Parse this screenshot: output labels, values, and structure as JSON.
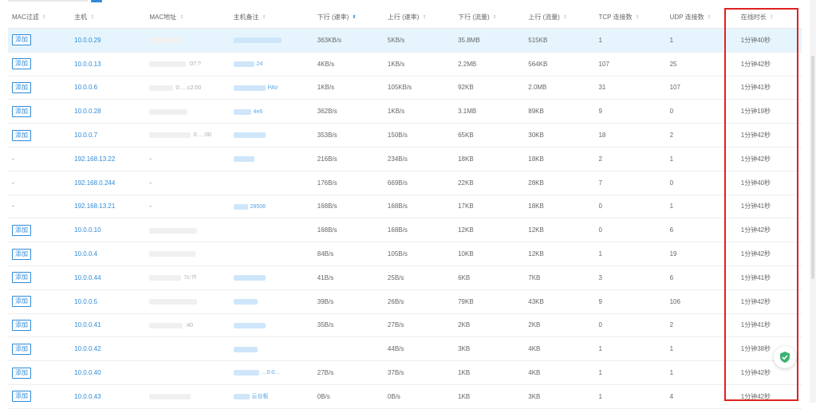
{
  "headers": [
    {
      "label": "MAC过滤",
      "sort_active": false
    },
    {
      "label": "主机",
      "sort_active": false
    },
    {
      "label": "MAC地址",
      "sort_active": false
    },
    {
      "label": "主机备注",
      "sort_active": false
    },
    {
      "label": "下行 (速率)",
      "sort_active": true
    },
    {
      "label": "上行 (速率)",
      "sort_active": false
    },
    {
      "label": "下行 (流量)",
      "sort_active": false
    },
    {
      "label": "上行 (流量)",
      "sort_active": false
    },
    {
      "label": "TCP 连接数",
      "sort_active": false
    },
    {
      "label": "UDP 连接数",
      "sort_active": false
    },
    {
      "label": "在线时长",
      "sort_active": false
    }
  ],
  "add_label": "添加",
  "empty_dash": "-",
  "rows": [
    {
      "filter": "add",
      "host": "10.0.0.29",
      "mac_frag": "",
      "note_frag": "",
      "down_rate": "363KB/s",
      "up_rate": "5KB/s",
      "down_flow": "35.8MB",
      "up_flow": "515KB",
      "tcp": "1",
      "udp": "1",
      "online": "1分钟40秒",
      "selected": true
    },
    {
      "filter": "add",
      "host": "10.0.0.13",
      "mac_frag": ":07:?",
      "note_frag": "24",
      "down_rate": "4KB/s",
      "up_rate": "1KB/s",
      "down_flow": "2.2MB",
      "up_flow": "564KB",
      "tcp": "107",
      "udp": "25",
      "online": "1分钟42秒"
    },
    {
      "filter": "add",
      "host": "10.0.0.6",
      "mac_frag": "0:…:c2:00",
      "note_frag": "PAV",
      "down_rate": "1KB/s",
      "up_rate": "105KB/s",
      "down_flow": "92KB",
      "up_flow": "2.0MB",
      "tcp": "31",
      "udp": "107",
      "online": "1分钟41秒"
    },
    {
      "filter": "add",
      "host": "10.0.0.28",
      "mac_frag": "",
      "note_frag": "4e6",
      "down_rate": "362B/s",
      "up_rate": "1KB/s",
      "down_flow": "3.1MB",
      "up_flow": "89KB",
      "tcp": "9",
      "udp": "0",
      "online": "1分钟19秒"
    },
    {
      "filter": "add",
      "host": "10.0.0.7",
      "mac_frag": "0:…:00",
      "note_frag": "",
      "down_rate": "353B/s",
      "up_rate": "150B/s",
      "down_flow": "65KB",
      "up_flow": "30KB",
      "tcp": "18",
      "udp": "2",
      "online": "1分钟42秒"
    },
    {
      "filter": "dash",
      "host": "192.168.13.22",
      "mac_frag": "",
      "note_frag": "",
      "down_rate": "216B/s",
      "up_rate": "234B/s",
      "down_flow": "18KB",
      "up_flow": "18KB",
      "tcp": "2",
      "udp": "1",
      "online": "1分钟42秒"
    },
    {
      "filter": "dash",
      "host": "192.168.0.244",
      "mac_frag": "",
      "note_frag": "",
      "down_rate": "176B/s",
      "up_rate": "669B/s",
      "down_flow": "22KB",
      "up_flow": "28KB",
      "tcp": "7",
      "udp": "0",
      "online": "1分钟40秒"
    },
    {
      "filter": "dash",
      "host": "192.168.13.21",
      "mac_frag": "",
      "note_frag": "28506",
      "down_rate": "168B/s",
      "up_rate": "168B/s",
      "down_flow": "17KB",
      "up_flow": "18KB",
      "tcp": "0",
      "udp": "1",
      "online": "1分钟41秒"
    },
    {
      "filter": "add",
      "host": "10.0.0.10",
      "mac_frag": "",
      "note_frag": "",
      "down_rate": "168B/s",
      "up_rate": "168B/s",
      "down_flow": "12KB",
      "up_flow": "12KB",
      "tcp": "0",
      "udp": "6",
      "online": "1分钟42秒"
    },
    {
      "filter": "add",
      "host": "10.0.0.4",
      "mac_frag": "",
      "note_frag": "",
      "down_rate": "84B/s",
      "up_rate": "105B/s",
      "down_flow": "10KB",
      "up_flow": "12KB",
      "tcp": "1",
      "udp": "19",
      "online": "1分钟42秒"
    },
    {
      "filter": "add",
      "host": "10.0.0.44",
      "mac_frag": "7c:7f",
      "note_frag": "",
      "down_rate": "41B/s",
      "up_rate": "25B/s",
      "down_flow": "6KB",
      "up_flow": "7KB",
      "tcp": "3",
      "udp": "6",
      "online": "1分钟41秒"
    },
    {
      "filter": "add",
      "host": "10.0.0.5",
      "mac_frag": "",
      "note_frag": "",
      "down_rate": "39B/s",
      "up_rate": "26B/s",
      "down_flow": "79KB",
      "up_flow": "43KB",
      "tcp": "9",
      "udp": "106",
      "online": "1分钟42秒"
    },
    {
      "filter": "add",
      "host": "10.0.0.41",
      "mac_frag": ":40",
      "note_frag": "",
      "down_rate": "35B/s",
      "up_rate": "27B/s",
      "down_flow": "2KB",
      "up_flow": "2KB",
      "tcp": "0",
      "udp": "2",
      "online": "1分钟41秒"
    },
    {
      "filter": "add",
      "host": "10.0.0.42",
      "mac_frag": "",
      "note_frag": "",
      "down_rate": "",
      "up_rate": "44B/s",
      "down_flow": "3KB",
      "up_flow": "4KB",
      "tcp": "1",
      "udp": "1",
      "online": "1分钟38秒"
    },
    {
      "filter": "add",
      "host": "10.0.0.40",
      "mac_frag": "",
      "note_frag": "…0:0…",
      "down_rate": "27B/s",
      "up_rate": "37B/s",
      "down_flow": "1KB",
      "up_flow": "4KB",
      "tcp": "1",
      "udp": "1",
      "online": "1分钟42秒"
    },
    {
      "filter": "add",
      "host": "10.0.0.43",
      "mac_frag": "",
      "note_frag": "云台板",
      "down_rate": "0B/s",
      "up_rate": "0B/s",
      "down_flow": "1KB",
      "up_flow": "3KB",
      "tcp": "1",
      "udp": "4",
      "online": "1分钟42秒"
    }
  ],
  "sort_icon": "sort-arrows-icon",
  "fab_icon": "shield-check-icon",
  "colors": {
    "accent": "#2f8bd8",
    "highlight": "#e02020",
    "selected_row": "#e6f5fd",
    "shield": "#3cb371"
  }
}
